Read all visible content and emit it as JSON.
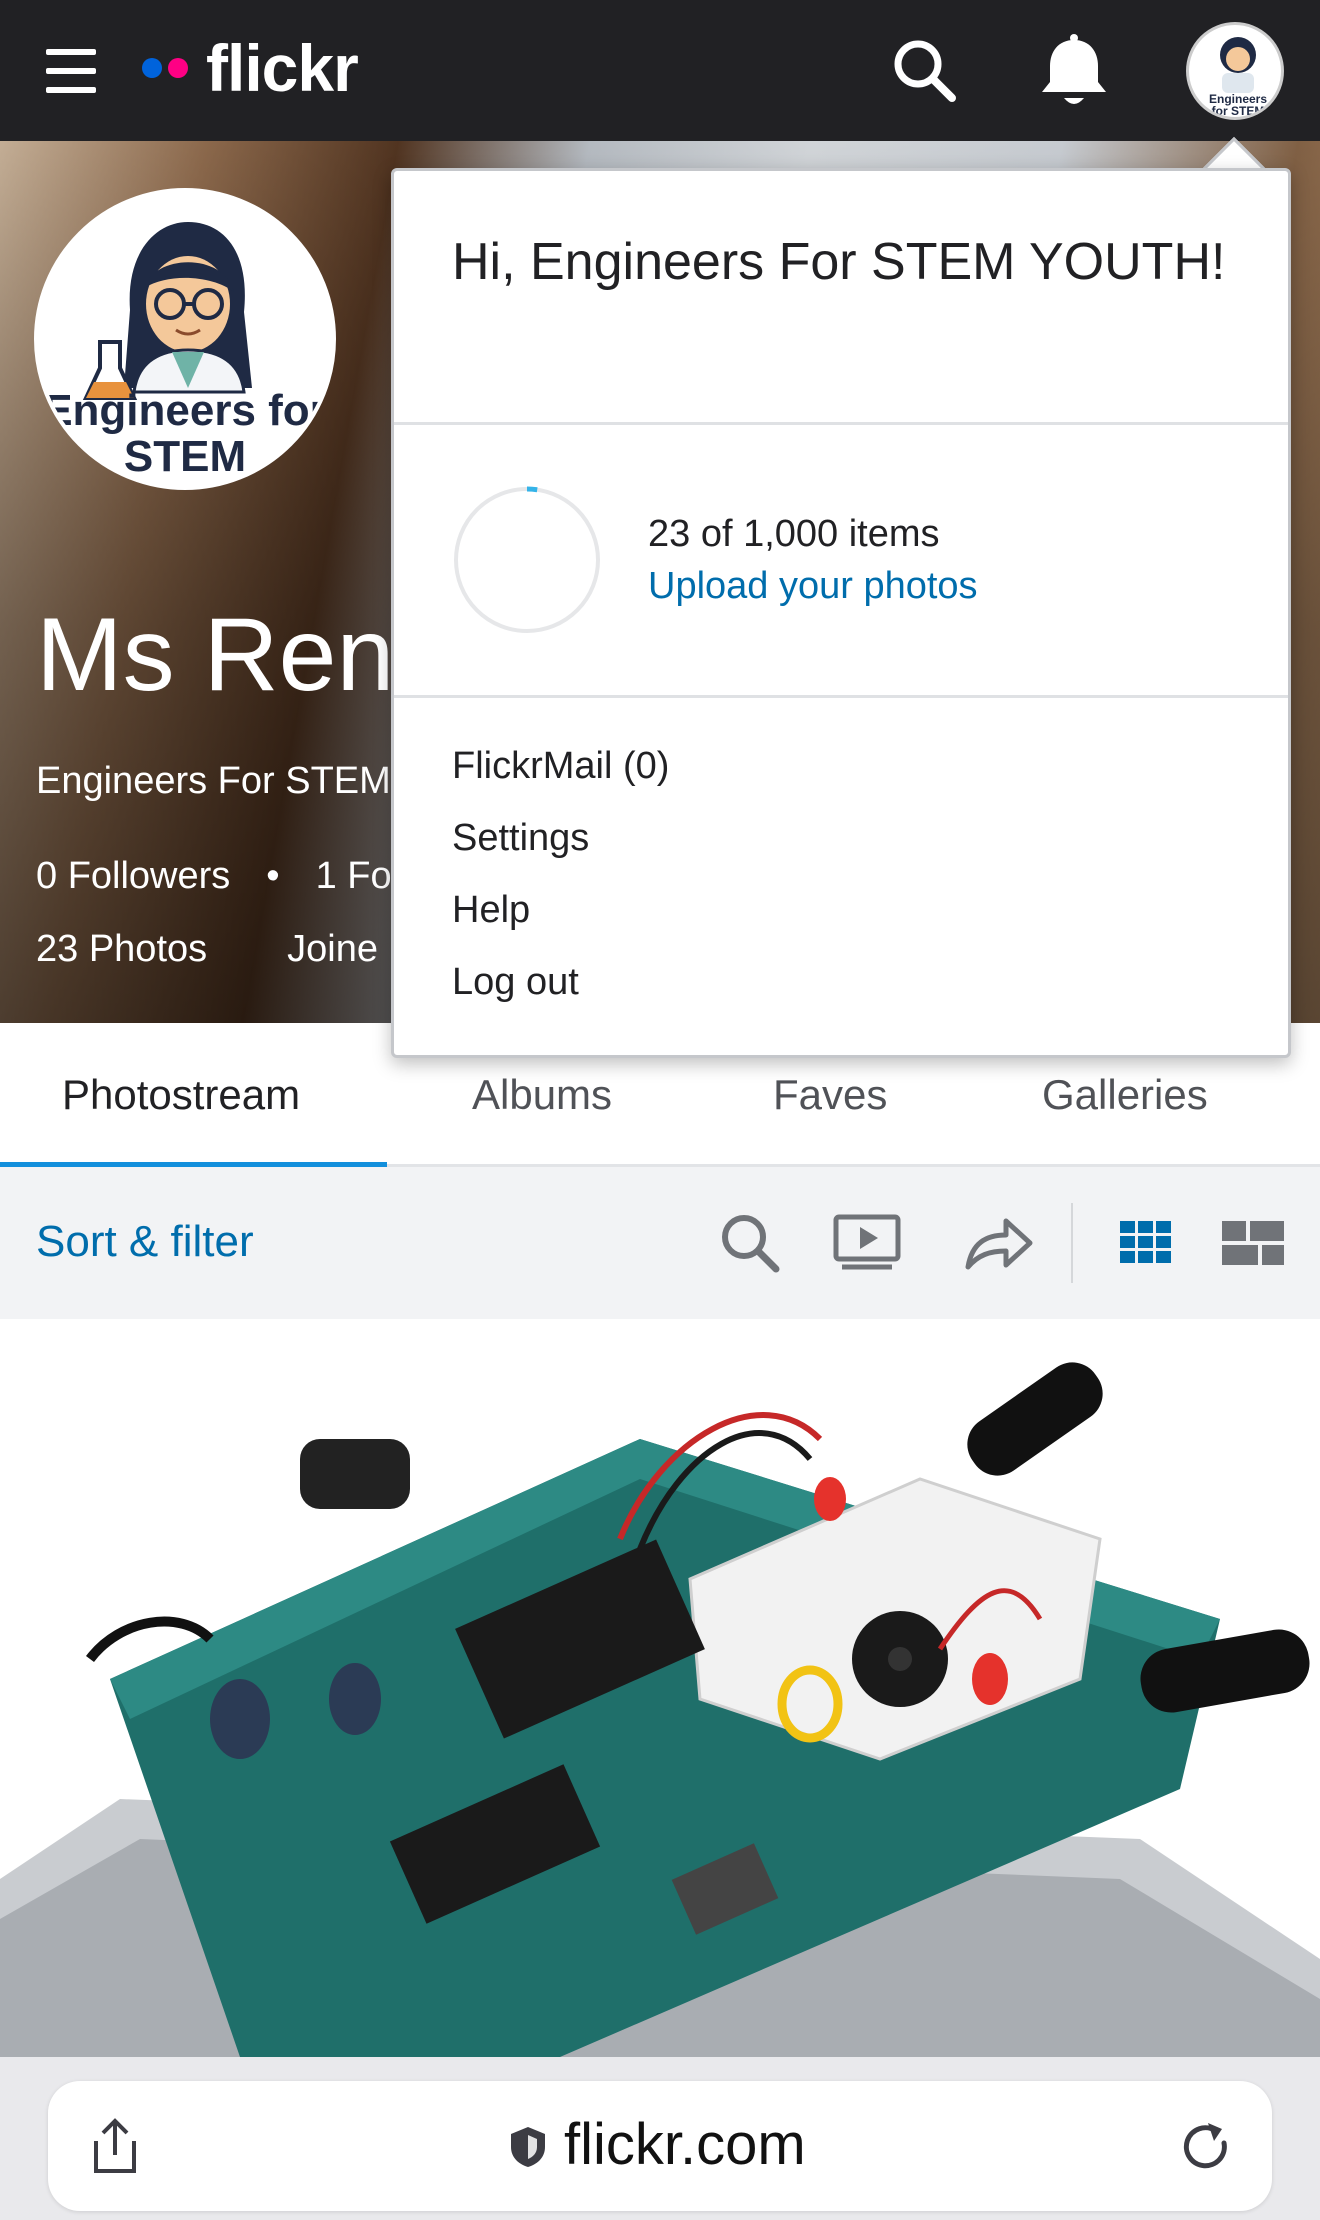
{
  "topbar": {
    "logo_text": "flickr",
    "colors": {
      "bar": "#212124",
      "logo_blue": "#0063dc",
      "logo_pink": "#ff0084"
    },
    "icons": [
      "hamburger-menu-icon",
      "search-icon",
      "notification-bell-icon",
      "account-avatar"
    ],
    "avatar_text": "Engineers for STEM"
  },
  "profile": {
    "avatar_text": "Engineers for STEM",
    "name": "Ms Rene",
    "subtitle": "Engineers For STEM",
    "followers": "0 Followers",
    "separator": "•",
    "following": "1 Fo",
    "photos": "23 Photos",
    "joined": "Joine"
  },
  "tabs": [
    {
      "label": "Photostream",
      "active": true
    },
    {
      "label": "Albums",
      "active": false
    },
    {
      "label": "Faves",
      "active": false
    },
    {
      "label": "Galleries",
      "active": false
    }
  ],
  "toolbar": {
    "sort_filter_label": "Sort & filter",
    "accent": "#006dac",
    "icons": [
      "search-icon",
      "slideshow-icon",
      "share-icon",
      "grid-view-icon",
      "justified-view-icon"
    ]
  },
  "dropdown": {
    "greeting": "Hi, Engineers For STEM YOUTH!",
    "items_count": "23 of 1,000 items",
    "upload_progress_fraction": 0.023,
    "upload_link": "Upload your photos",
    "menu": [
      "FlickrMail (0)",
      "Settings",
      "Help",
      "Log out"
    ]
  },
  "browser": {
    "url": "flickr.com",
    "icons": [
      "share-icon",
      "shield-icon",
      "reload-icon"
    ]
  }
}
